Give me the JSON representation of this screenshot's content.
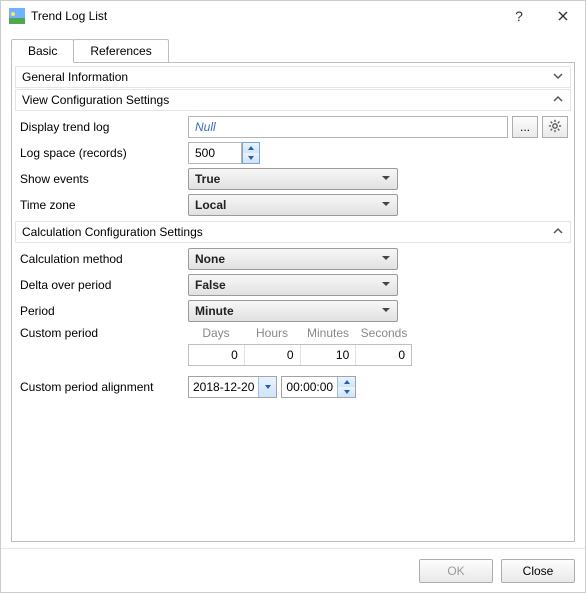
{
  "title": "Trend Log List",
  "tabs": {
    "basic": "Basic",
    "references": "References"
  },
  "sections": {
    "general": {
      "title": "General Information",
      "expanded": false
    },
    "view": {
      "title": "View Configuration Settings",
      "expanded": true
    },
    "calc": {
      "title": "Calculation Configuration Settings",
      "expanded": true
    }
  },
  "labels": {
    "display_trend_log": "Display trend log",
    "log_space": "Log space (records)",
    "show_events": "Show events",
    "time_zone": "Time zone",
    "calc_method": "Calculation method",
    "delta_period": "Delta over period",
    "period": "Period",
    "custom_period": "Custom period",
    "custom_period_alignment": "Custom period alignment"
  },
  "values": {
    "display_trend_log": "Null",
    "log_space": "500",
    "show_events": "True",
    "time_zone": "Local",
    "calc_method": "None",
    "delta_period": "False",
    "period": "Minute",
    "custom_days": "0",
    "custom_hours": "0",
    "custom_minutes": "10",
    "custom_seconds": "0",
    "align_date": "2018-12-20",
    "align_time": "00:00:00"
  },
  "period_headers": {
    "days": "Days",
    "hours": "Hours",
    "minutes": "Minutes",
    "seconds": "Seconds"
  },
  "buttons": {
    "ok": "OK",
    "close": "Close",
    "browse": "..."
  },
  "icons": {
    "gear": "gear-icon",
    "help": "?",
    "close": "×"
  }
}
